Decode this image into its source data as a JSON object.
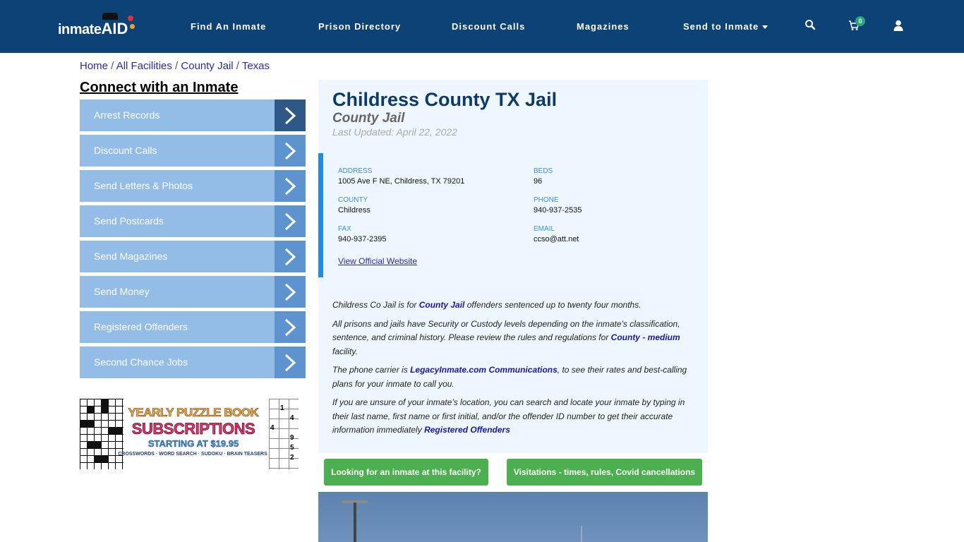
{
  "nav": {
    "logo_text": "inmate",
    "logo_aid": "AID",
    "links": [
      "Find An Inmate",
      "Prison Directory",
      "Discount Calls",
      "Magazines",
      "Send to Inmate"
    ],
    "cart_count": "0",
    "icons": [
      "search-icon",
      "cart-icon",
      "user-icon"
    ]
  },
  "breadcrumb": {
    "items": [
      "Home",
      "All Facilities",
      "County Jail",
      "Texas"
    ],
    "separator": " / "
  },
  "sidebar": {
    "title": "Connect with an Inmate",
    "items": [
      {
        "label": "Arrest Records",
        "active": true
      },
      {
        "label": "Discount Calls"
      },
      {
        "label": "Send Letters & Photos"
      },
      {
        "label": "Send Postcards"
      },
      {
        "label": "Send Magazines"
      },
      {
        "label": "Send Money"
      },
      {
        "label": "Registered Offenders"
      },
      {
        "label": "Second Chance Jobs"
      }
    ],
    "ad": {
      "line1": "YEARLY PUZZLE BOOK",
      "line2": "SUBSCRIPTIONS",
      "line3": "STARTING AT $19.95",
      "line4": "CROSSWORDS · WORD SEARCH · SUDOKU · BRAIN TEASERS",
      "sudoku_digits": [
        "1",
        "4",
        "4",
        "9",
        "5",
        "2"
      ]
    }
  },
  "facility": {
    "title": "Childress County TX Jail",
    "type": "County Jail",
    "last_updated": "Last Updated: April 22, 2022",
    "info": {
      "address_label": "ADDRESS",
      "address": "1005 Ave F NE, Childress, TX 79201",
      "beds_label": "BEDS",
      "beds": "96",
      "county_label": "COUNTY",
      "county": "Childress",
      "phone_label": "PHONE",
      "phone": "940-937-2535",
      "fax_label": "FAX",
      "fax": "940-937-2395",
      "email_label": "EMAIL",
      "email": "ccso@att.net",
      "website_link": "View Official Website"
    },
    "description": {
      "p1_a": "Childress Co Jail is for ",
      "p1_link": "County Jail",
      "p1_b": " offenders sentenced up to twenty four months.",
      "p2_a": "All prisons and jails have Security or Custody levels depending on the inmate's classification, sentence, and criminal history. Please review the rules and regulations for ",
      "p2_link": "County - medium",
      "p2_b": " facility.",
      "p3_a": "The phone carrier is ",
      "p3_link": "LegacyInmate.com Communications",
      "p3_b": ", to see their rates and best-calling plans for your inmate to call you.",
      "p4_a": "If you are unsure of your inmate's location, you can search and locate your inmate by typing in their last name, first name or first initial, and/or the offender ID number to get their accurate information immediately ",
      "p4_link": "Registered Offenders"
    },
    "buttons": {
      "find_inmate": "Looking for an inmate at this facility?",
      "visitation": "Visitations - times, rules, Covid cancellations"
    }
  },
  "colors": {
    "nav_bg": "#0c4275",
    "sidebar_item": "#93bde6",
    "sidebar_arrow": "#5d93cf",
    "accent_blue": "#1e8de8",
    "button_green": "#4caf50"
  }
}
